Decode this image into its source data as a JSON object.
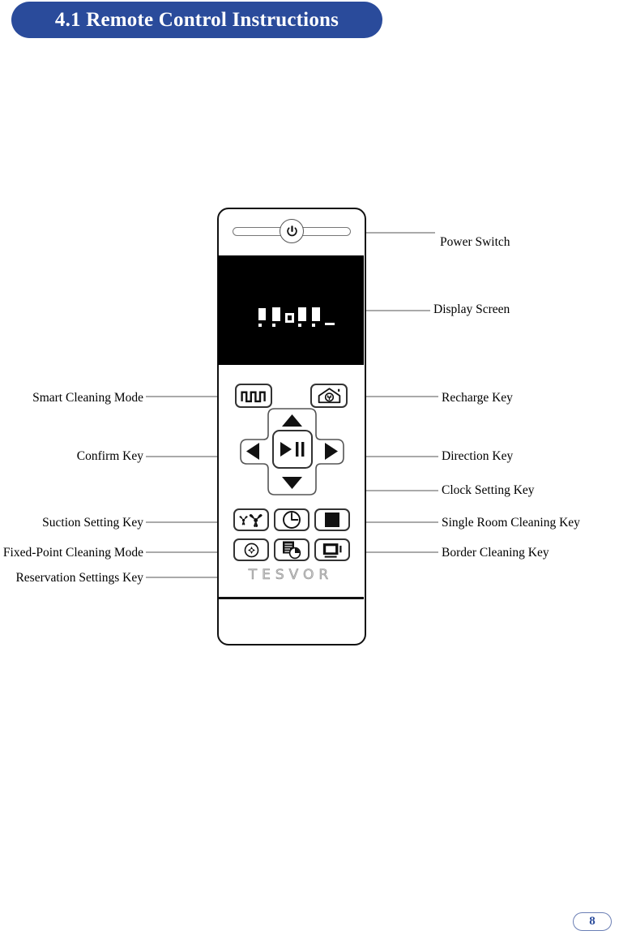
{
  "header": {
    "title": "4.1 Remote Control Instructions",
    "pill_color": "#2A4B9B"
  },
  "remote": {
    "brand": "TESVOR",
    "power_button": {
      "icon": "power-icon"
    },
    "display": {
      "icon": "lcd-display"
    },
    "keys": [
      {
        "id": "smart-cleaning",
        "icon": "zigzag-wave-icon"
      },
      {
        "id": "recharge",
        "icon": "house-plug-icon"
      },
      {
        "id": "direction-up",
        "icon": "arrow-up-icon"
      },
      {
        "id": "direction-down",
        "icon": "arrow-down-icon"
      },
      {
        "id": "direction-left",
        "icon": "arrow-left-icon"
      },
      {
        "id": "direction-right",
        "icon": "arrow-right-icon"
      },
      {
        "id": "confirm",
        "icon": "play-pause-icon"
      },
      {
        "id": "suction-setting",
        "icon": "dual-fan-icon"
      },
      {
        "id": "clock-setting",
        "icon": "clock-icon"
      },
      {
        "id": "single-room-cleaning",
        "icon": "filled-square-icon"
      },
      {
        "id": "fixed-point-cleaning",
        "icon": "spiral-target-icon"
      },
      {
        "id": "reservation-settings",
        "icon": "document-clock-icon"
      },
      {
        "id": "border-cleaning",
        "icon": "nested-rectangles-icon"
      }
    ]
  },
  "callouts": {
    "right": [
      {
        "id": "power-switch",
        "label": "Power Switch"
      },
      {
        "id": "display-screen",
        "label": "Display Screen"
      },
      {
        "id": "recharge-key",
        "label": "Recharge Key"
      },
      {
        "id": "direction-key",
        "label": "Direction Key"
      },
      {
        "id": "clock-setting-key",
        "label": "Clock Setting Key"
      },
      {
        "id": "single-room-cleaning-key",
        "label": "Single Room Cleaning Key"
      },
      {
        "id": "border-cleaning-key",
        "label": "Border Cleaning Key"
      }
    ],
    "left": [
      {
        "id": "smart-cleaning-mode",
        "label": "Smart Cleaning Mode"
      },
      {
        "id": "confirm-key",
        "label": "Confirm Key"
      },
      {
        "id": "suction-setting-key",
        "label": "Suction Setting Key"
      },
      {
        "id": "fixed-point-cleaning-mode",
        "label": "Fixed-Point Cleaning Mode"
      },
      {
        "id": "reservation-settings-key",
        "label": "Reservation Settings Key"
      }
    ]
  },
  "footer": {
    "page_number": "8"
  }
}
